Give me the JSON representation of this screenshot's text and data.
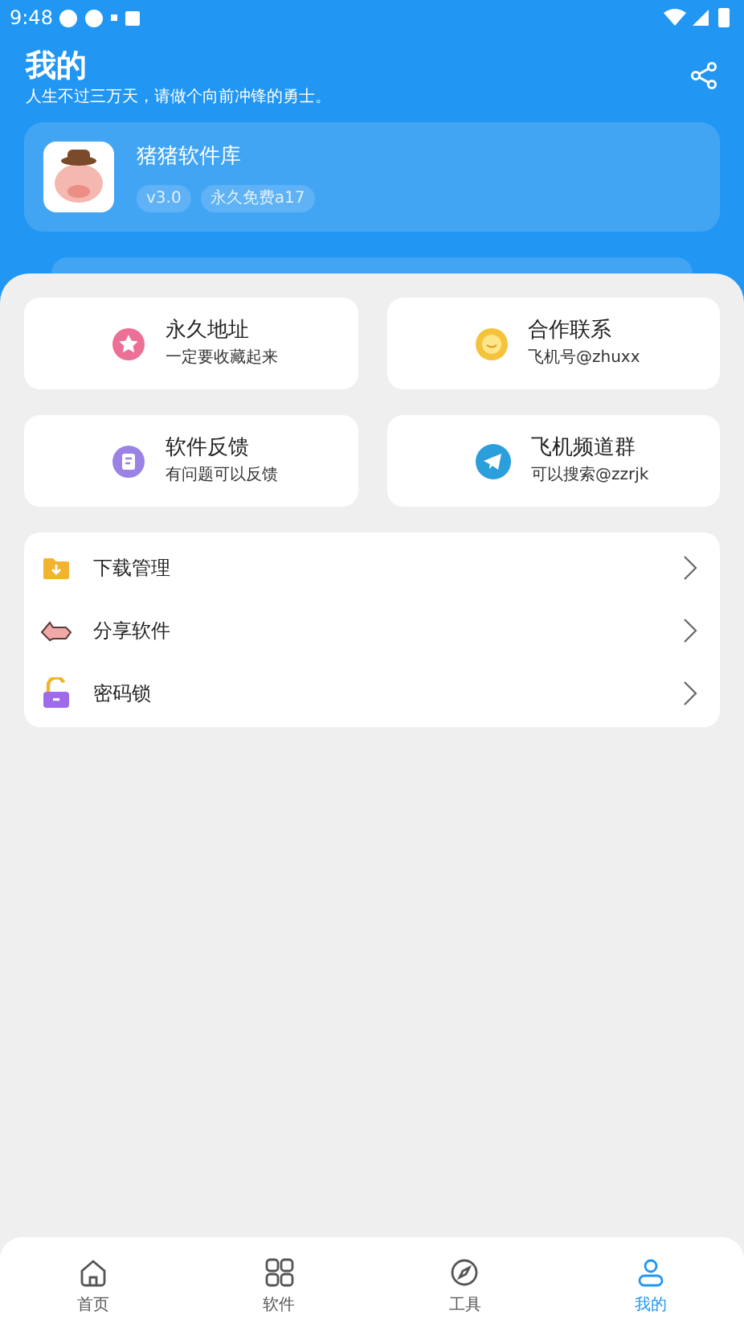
{
  "status_bar": {
    "time": "9:48"
  },
  "header": {
    "title": "我的",
    "subtitle": "人生不过三万天，请做个向前冲锋的勇士。"
  },
  "profile": {
    "name": "猪猪软件库",
    "tags": [
      "v3.0",
      "永久免费a17"
    ]
  },
  "quick_cards": [
    {
      "title": "永久地址",
      "subtitle": "一定要收藏起来",
      "kind": "star"
    },
    {
      "title": "合作联系",
      "subtitle": "飞机号@zhuxx",
      "kind": "chat"
    },
    {
      "title": "软件反馈",
      "subtitle": "有问题可以反馈",
      "kind": "note"
    },
    {
      "title": "飞机频道群",
      "subtitle": "可以搜索@zzrjk",
      "kind": "plane"
    }
  ],
  "menu": [
    {
      "label": "下载管理",
      "kind": "download"
    },
    {
      "label": "分享软件",
      "kind": "share"
    },
    {
      "label": "密码锁",
      "kind": "lock"
    }
  ],
  "bottom_nav": [
    {
      "label": "首页",
      "kind": "home",
      "selected": false
    },
    {
      "label": "软件",
      "kind": "apps",
      "selected": false
    },
    {
      "label": "工具",
      "kind": "compass",
      "selected": false
    },
    {
      "label": "我的",
      "kind": "user",
      "selected": true
    }
  ]
}
